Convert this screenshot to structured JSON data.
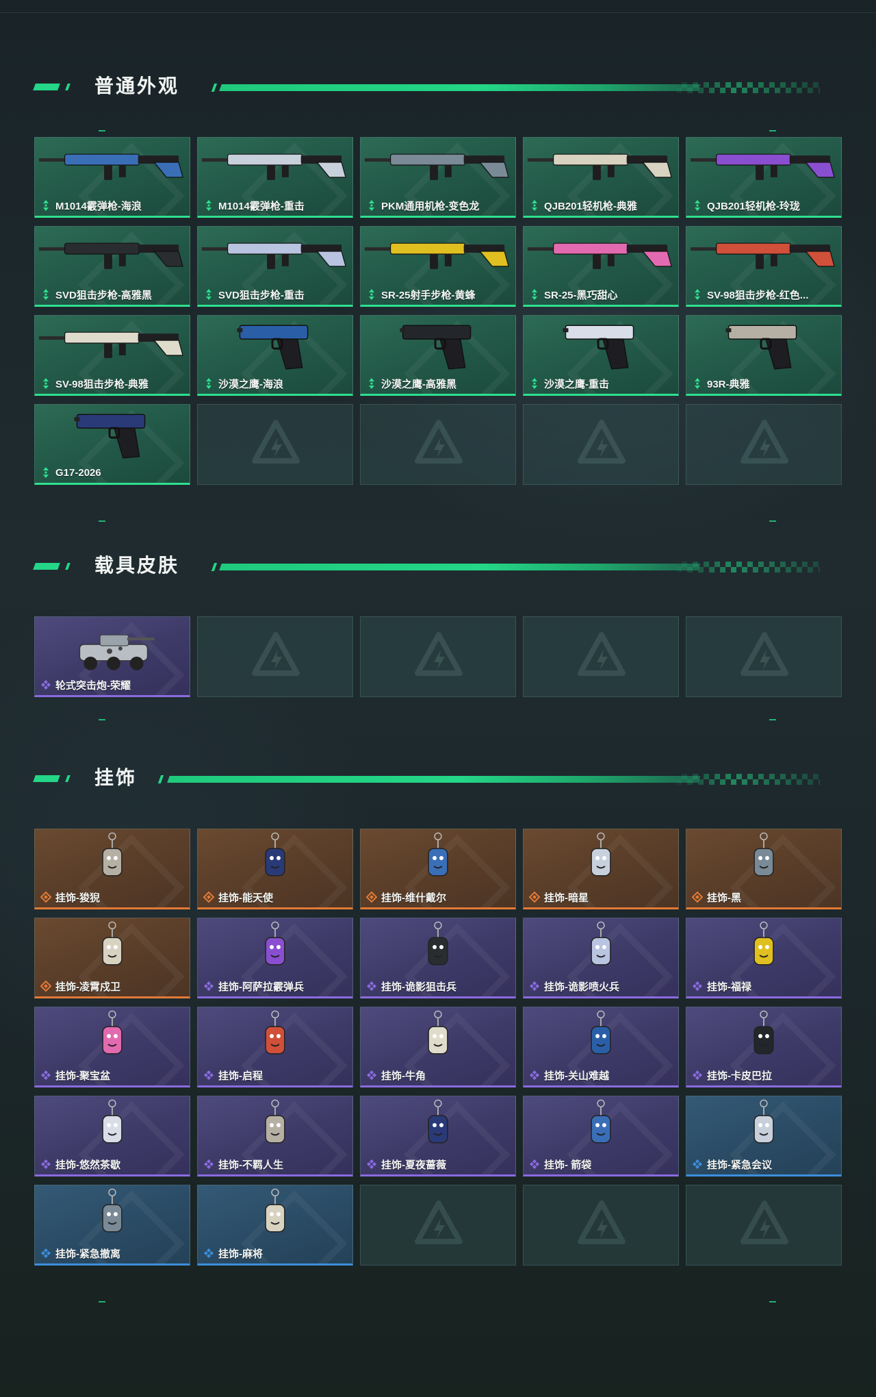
{
  "sections": [
    {
      "title": "普通外观",
      "items": [
        {
          "name": "M1014霰弹枪-海浪",
          "icon": "shotgun-icon",
          "rarity": "green"
        },
        {
          "name": "M1014霰弹枪-重击",
          "icon": "shotgun-icon",
          "rarity": "green"
        },
        {
          "name": "PKM通用机枪-变色龙",
          "icon": "machine-gun-icon",
          "rarity": "green"
        },
        {
          "name": "QJB201轻机枪-典雅",
          "icon": "light-machine-gun-icon",
          "rarity": "green"
        },
        {
          "name": "QJB201轻机枪-玲珑",
          "icon": "light-machine-gun-icon",
          "rarity": "green"
        },
        {
          "name": "SVD狙击步枪-高雅黑",
          "icon": "sniper-rifle-icon",
          "rarity": "green"
        },
        {
          "name": "SVD狙击步枪-重击",
          "icon": "sniper-rifle-icon",
          "rarity": "green"
        },
        {
          "name": "SR-25射手步枪-黄蜂",
          "icon": "marksman-rifle-icon",
          "rarity": "green"
        },
        {
          "name": "SR-25-黑巧甜心",
          "icon": "marksman-rifle-icon",
          "rarity": "green"
        },
        {
          "name": "SV-98狙击步枪-红色...",
          "icon": "sniper-rifle-icon",
          "rarity": "green"
        },
        {
          "name": "SV-98狙击步枪-典雅",
          "icon": "sniper-rifle-icon",
          "rarity": "green"
        },
        {
          "name": "沙漠之鹰-海浪",
          "icon": "pistol-icon",
          "rarity": "green"
        },
        {
          "name": "沙漠之鹰-高雅黑",
          "icon": "pistol-icon",
          "rarity": "green"
        },
        {
          "name": "沙漠之鹰-重击",
          "icon": "pistol-icon",
          "rarity": "green"
        },
        {
          "name": "93R-典雅",
          "icon": "pistol-icon",
          "rarity": "green"
        },
        {
          "name": "G17-2026",
          "icon": "pistol-icon",
          "rarity": "green"
        }
      ]
    },
    {
      "title": "载具皮肤",
      "items": [
        {
          "name": "轮式突击炮-荣耀",
          "icon": "armored-vehicle-icon",
          "rarity": "purple"
        }
      ]
    },
    {
      "title": "挂饰",
      "items": [
        {
          "name": "挂饰-狻猊",
          "icon": "charm-icon",
          "rarity": "orange"
        },
        {
          "name": "挂饰-能天使",
          "icon": "charm-icon",
          "rarity": "orange"
        },
        {
          "name": "挂饰-维什戴尔",
          "icon": "charm-icon",
          "rarity": "orange"
        },
        {
          "name": "挂饰-暗星",
          "icon": "charm-icon",
          "rarity": "orange"
        },
        {
          "name": "挂饰-黑",
          "icon": "charm-icon",
          "rarity": "orange"
        },
        {
          "name": "挂饰-凌霄戍卫",
          "icon": "charm-icon",
          "rarity": "orange"
        },
        {
          "name": "挂饰-阿萨拉霰弹兵",
          "icon": "charm-icon",
          "rarity": "purple"
        },
        {
          "name": "挂饰-诡影狙击兵",
          "icon": "charm-icon",
          "rarity": "purple"
        },
        {
          "name": "挂饰-诡影喷火兵",
          "icon": "charm-icon",
          "rarity": "purple"
        },
        {
          "name": "挂饰-福禄",
          "icon": "charm-icon",
          "rarity": "purple"
        },
        {
          "name": "挂饰-聚宝盆",
          "icon": "charm-icon",
          "rarity": "purple"
        },
        {
          "name": "挂饰-启程",
          "icon": "charm-icon",
          "rarity": "purple"
        },
        {
          "name": "挂饰-牛角",
          "icon": "charm-icon",
          "rarity": "purple"
        },
        {
          "name": "挂饰-关山难越",
          "icon": "charm-icon",
          "rarity": "purple"
        },
        {
          "name": "挂饰-卡皮巴拉",
          "icon": "charm-icon",
          "rarity": "purple"
        },
        {
          "name": "挂饰-悠然茶歇",
          "icon": "charm-icon",
          "rarity": "purple"
        },
        {
          "name": "挂饰-不羁人生",
          "icon": "charm-icon",
          "rarity": "purple"
        },
        {
          "name": "挂饰-夏夜蔷薇",
          "icon": "charm-icon",
          "rarity": "purple"
        },
        {
          "name": "挂饰- 箭袋",
          "icon": "charm-icon",
          "rarity": "purple"
        },
        {
          "name": "挂饰-紧急会议",
          "icon": "charm-icon",
          "rarity": "blue"
        },
        {
          "name": "挂饰-紧急撤离",
          "icon": "charm-icon",
          "rarity": "blue"
        },
        {
          "name": "挂饰-麻将",
          "icon": "charm-icon",
          "rarity": "blue"
        }
      ]
    }
  ],
  "empty_slot_icon": "brand-logo-placeholder-icon",
  "colors": {
    "accent": "#24d687",
    "rarity_green": "#2ee08f",
    "rarity_purple": "#8a6be0",
    "rarity_orange": "#e47a36",
    "rarity_blue": "#3c8fdc"
  }
}
